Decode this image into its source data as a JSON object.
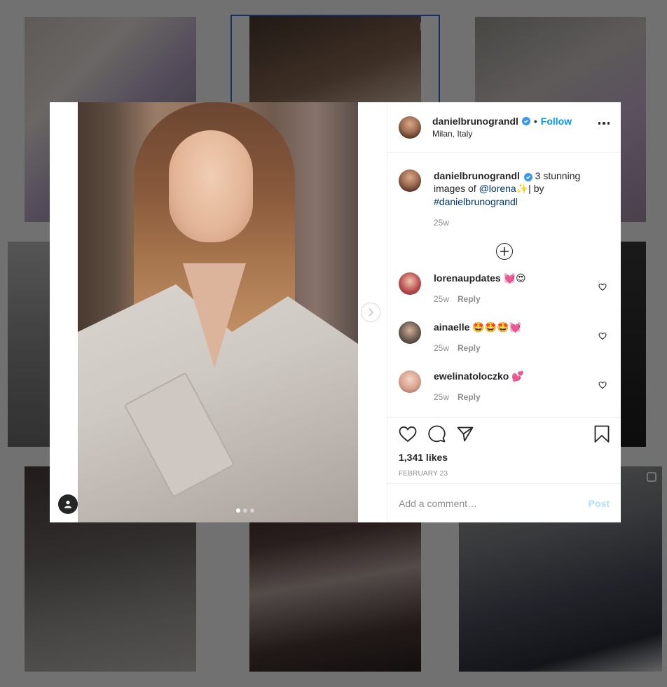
{
  "post": {
    "username": "danielbrunogrand",
    "username_full": "danielbrunogrand",
    "follow_label": "Follow",
    "separator": "•",
    "location": "Milan, Italy",
    "caption_text": " 3 stunning images of ",
    "caption_mention": "@lorena",
    "caption_emoji": "✨",
    "caption_mid": "| by ",
    "caption_hashtag": "#danielbrunograndl",
    "caption_time": "25w",
    "likes": "1,341 likes",
    "date": "FEBRUARY 23",
    "comment_placeholder": "Add a comment…",
    "post_label": "Post"
  },
  "header_user": "danielbrunograndl",
  "caption_user": "danielbrunograndl",
  "comments": [
    {
      "user": "lorenaupdates",
      "text": "💓😍",
      "time": "25w",
      "reply": "Reply"
    },
    {
      "user": "ainaelle",
      "text": "🤩🤩🤩💓",
      "time": "25w",
      "reply": "Reply"
    },
    {
      "user": "ewelinatoloczko",
      "text": "💕",
      "time": "25w",
      "reply": "Reply"
    }
  ],
  "colors": {
    "accent": "#0095f6",
    "verified": "#3897f0",
    "post_disabled": "#b2dffc",
    "muted": "#8e8e8e"
  }
}
